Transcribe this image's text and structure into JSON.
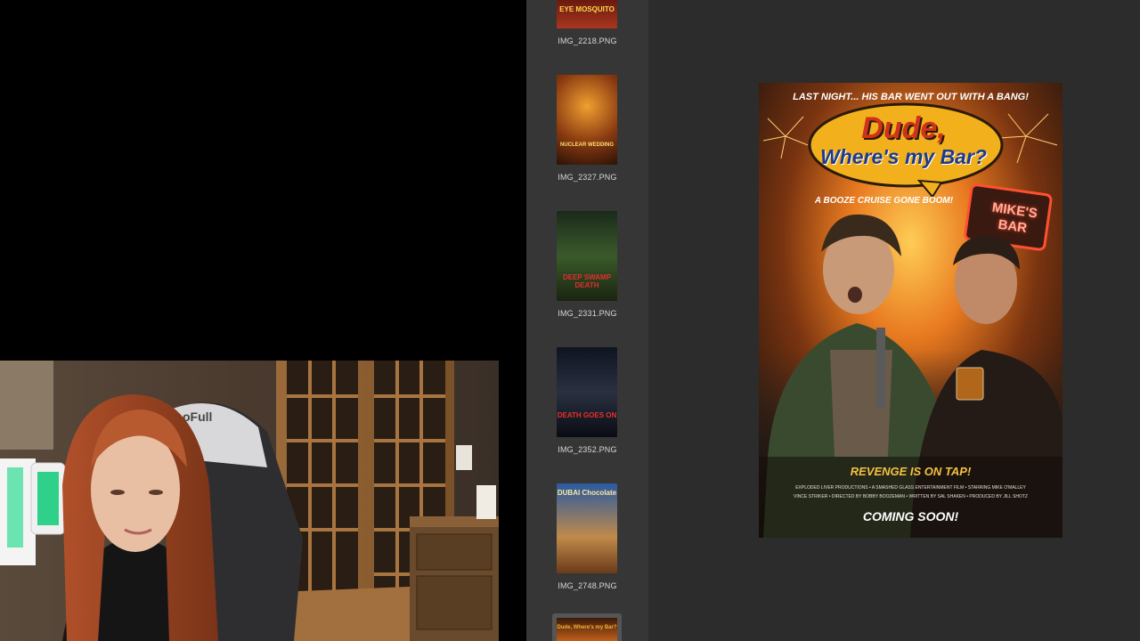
{
  "colors": {
    "sidebar_bg": "#363636",
    "preview_bg": "#2c2c2c",
    "accent_orange": "#f5a623"
  },
  "sidebar": {
    "items": [
      {
        "filename": "IMG_2218.PNG",
        "thumb_title": "EYE MOSQUITO",
        "selected": false
      },
      {
        "filename": "IMG_2327.PNG",
        "thumb_title": "NUCLEAR WEDDING",
        "selected": false
      },
      {
        "filename": "IMG_2331.PNG",
        "thumb_title": "DEEP SWAMP DEATH",
        "selected": false
      },
      {
        "filename": "IMG_2352.PNG",
        "thumb_title": "DEATH GOES ON",
        "selected": false
      },
      {
        "filename": "IMG_2748.PNG",
        "thumb_title": "DUBAI Chocolate",
        "selected": false
      },
      {
        "filename": "",
        "thumb_title": "Dude, Where's my Bar?",
        "selected": true
      }
    ]
  },
  "poster": {
    "tagline_top": "LAST NIGHT... HIS BAR WENT OUT WITH A BANG!",
    "title_line1": "Dude,",
    "title_line2": "Where's my Bar?",
    "subtitle": "A BOOZE CRUISE GONE BOOM!",
    "sign_line1": "MIKE'S",
    "sign_line2": "BAR",
    "tagline_bottom": "REVENGE IS ON TAP!",
    "credits_line1": "EXPLODED LIVER PRODUCTIONS • A SMASHED GLASS ENTERTAINMENT FILM • STARRING MIKE O'MALLEY",
    "credits_line2": "VINCE STRIKER • DIRECTED BY BOBBY BOOZEMAN • WRITTEN BY SAL SHAKEN • PRODUCED BY JILL SHOTZ",
    "coming_soon": "COMING SOON!"
  },
  "webcam": {
    "chair_brand": "oFull"
  }
}
